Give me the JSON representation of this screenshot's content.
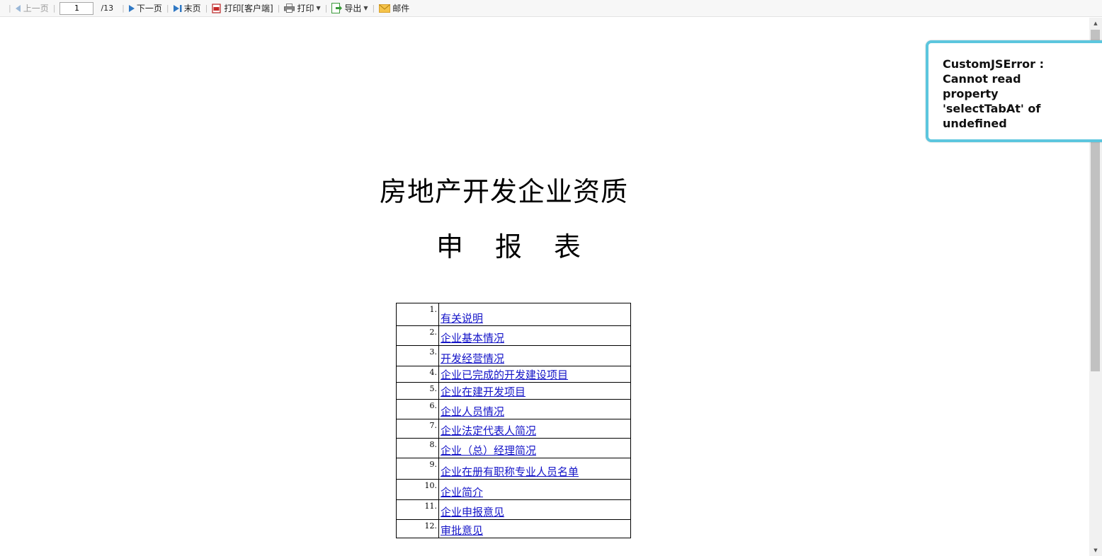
{
  "toolbar": {
    "prev_label": "上一页",
    "page_current": "1",
    "page_total": "/13",
    "next_label": "下一页",
    "last_label": "末页",
    "print_client_label": "打印[客户端]",
    "print_label": "打印",
    "export_label": "导出",
    "mail_label": "邮件"
  },
  "document": {
    "title_line1": "房地产开发企业资质",
    "title_line2": [
      "申",
      "报",
      "表"
    ],
    "toc": [
      {
        "num": "1.",
        "label": "有关说明"
      },
      {
        "num": "2.",
        "label": "企业基本情况"
      },
      {
        "num": "3.",
        "label": "开发经营情况"
      },
      {
        "num": "4.",
        "label": "企业已完成的开发建设项目"
      },
      {
        "num": "5.",
        "label": "企业在建开发项目"
      },
      {
        "num": "6.",
        "label": "企业人员情况"
      },
      {
        "num": "7.",
        "label": "企业法定代表人简况"
      },
      {
        "num": "8.",
        "label": "企业（总）经理简况"
      },
      {
        "num": "9.",
        "label": "企业在册有职称专业人员名单"
      },
      {
        "num": "10.",
        "label": "企业简介"
      },
      {
        "num": "11.",
        "label": "企业申报意见"
      },
      {
        "num": "12.",
        "label": "审批意见"
      }
    ]
  },
  "error": {
    "message": "CustomJSError : Cannot read property 'selectTabAt' of undefined"
  },
  "colors": {
    "link": "#1515c8",
    "popup_border": "#5cc6de"
  }
}
